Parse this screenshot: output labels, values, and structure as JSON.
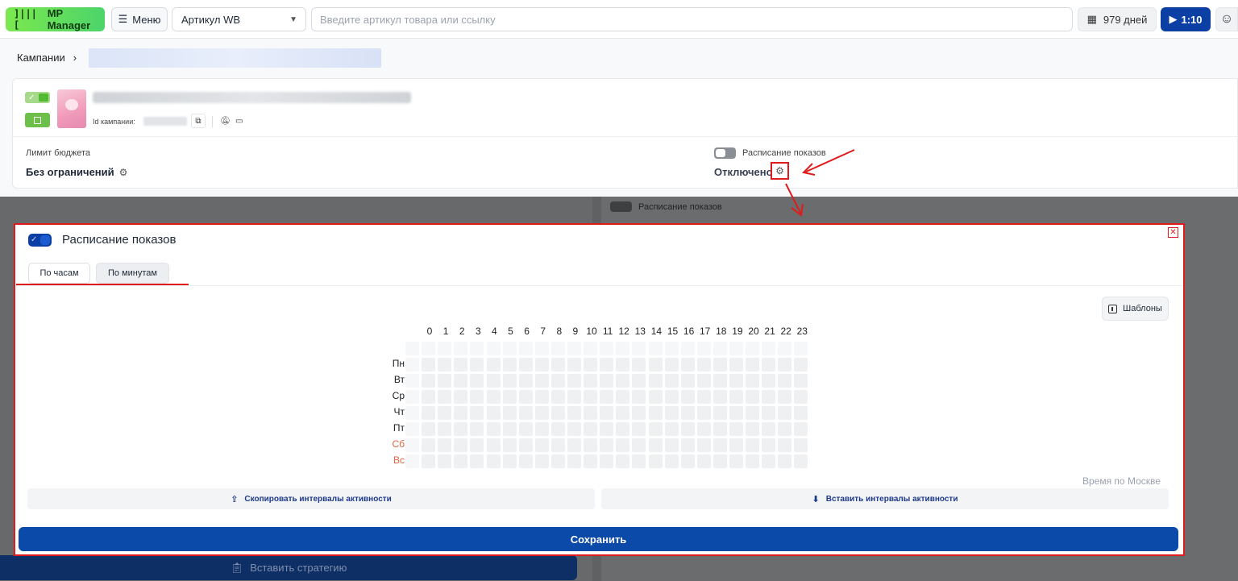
{
  "topbar": {
    "logo_text": "MP Manager",
    "logo_mark": "]|||[",
    "menu_label": "Меню",
    "article_select_value": "Артикул WB",
    "search_placeholder": "Введите артикул товара или ссылку",
    "days_label": "979 дней",
    "video_label": "1:10",
    "accent_color": "#0b3fa3",
    "logo_color": "#5ad85c"
  },
  "breadcrumb": {
    "root": "Кампании",
    "separator": "›"
  },
  "campaign": {
    "id_label": "Id кампании:",
    "budget_label": "Лимит бюджета",
    "budget_value": "Без ограничений",
    "schedule_label": "Расписание показов",
    "schedule_value": "Отключено",
    "schedule_enabled": false
  },
  "background": {
    "schedule_label": "Расписание показов",
    "insert_strategy_label": "Вставить стратегию"
  },
  "modal": {
    "title": "Расписание показов",
    "enabled": true,
    "tabs": [
      {
        "label": "По часам",
        "active": true
      },
      {
        "label": "По минутам",
        "active": false
      }
    ],
    "templates_label": "Шаблоны",
    "hours": [
      "0",
      "1",
      "2",
      "3",
      "4",
      "5",
      "6",
      "7",
      "8",
      "9",
      "10",
      "11",
      "12",
      "13",
      "14",
      "15",
      "16",
      "17",
      "18",
      "19",
      "20",
      "21",
      "22",
      "23"
    ],
    "days": [
      {
        "label": "Пн",
        "weekend": false
      },
      {
        "label": "Вт",
        "weekend": false
      },
      {
        "label": "Ср",
        "weekend": false
      },
      {
        "label": "Чт",
        "weekend": false
      },
      {
        "label": "Пт",
        "weekend": false
      },
      {
        "label": "Сб",
        "weekend": true
      },
      {
        "label": "Вс",
        "weekend": true
      }
    ],
    "timezone_note": "Время по Москве",
    "copy_label": "Скопировать интервалы активности",
    "paste_label": "Вставить интервалы активности",
    "save_label": "Сохранить",
    "close_glyph": "✕",
    "weekend_color": "#e1663f",
    "highlight_color": "#e01b1b"
  }
}
